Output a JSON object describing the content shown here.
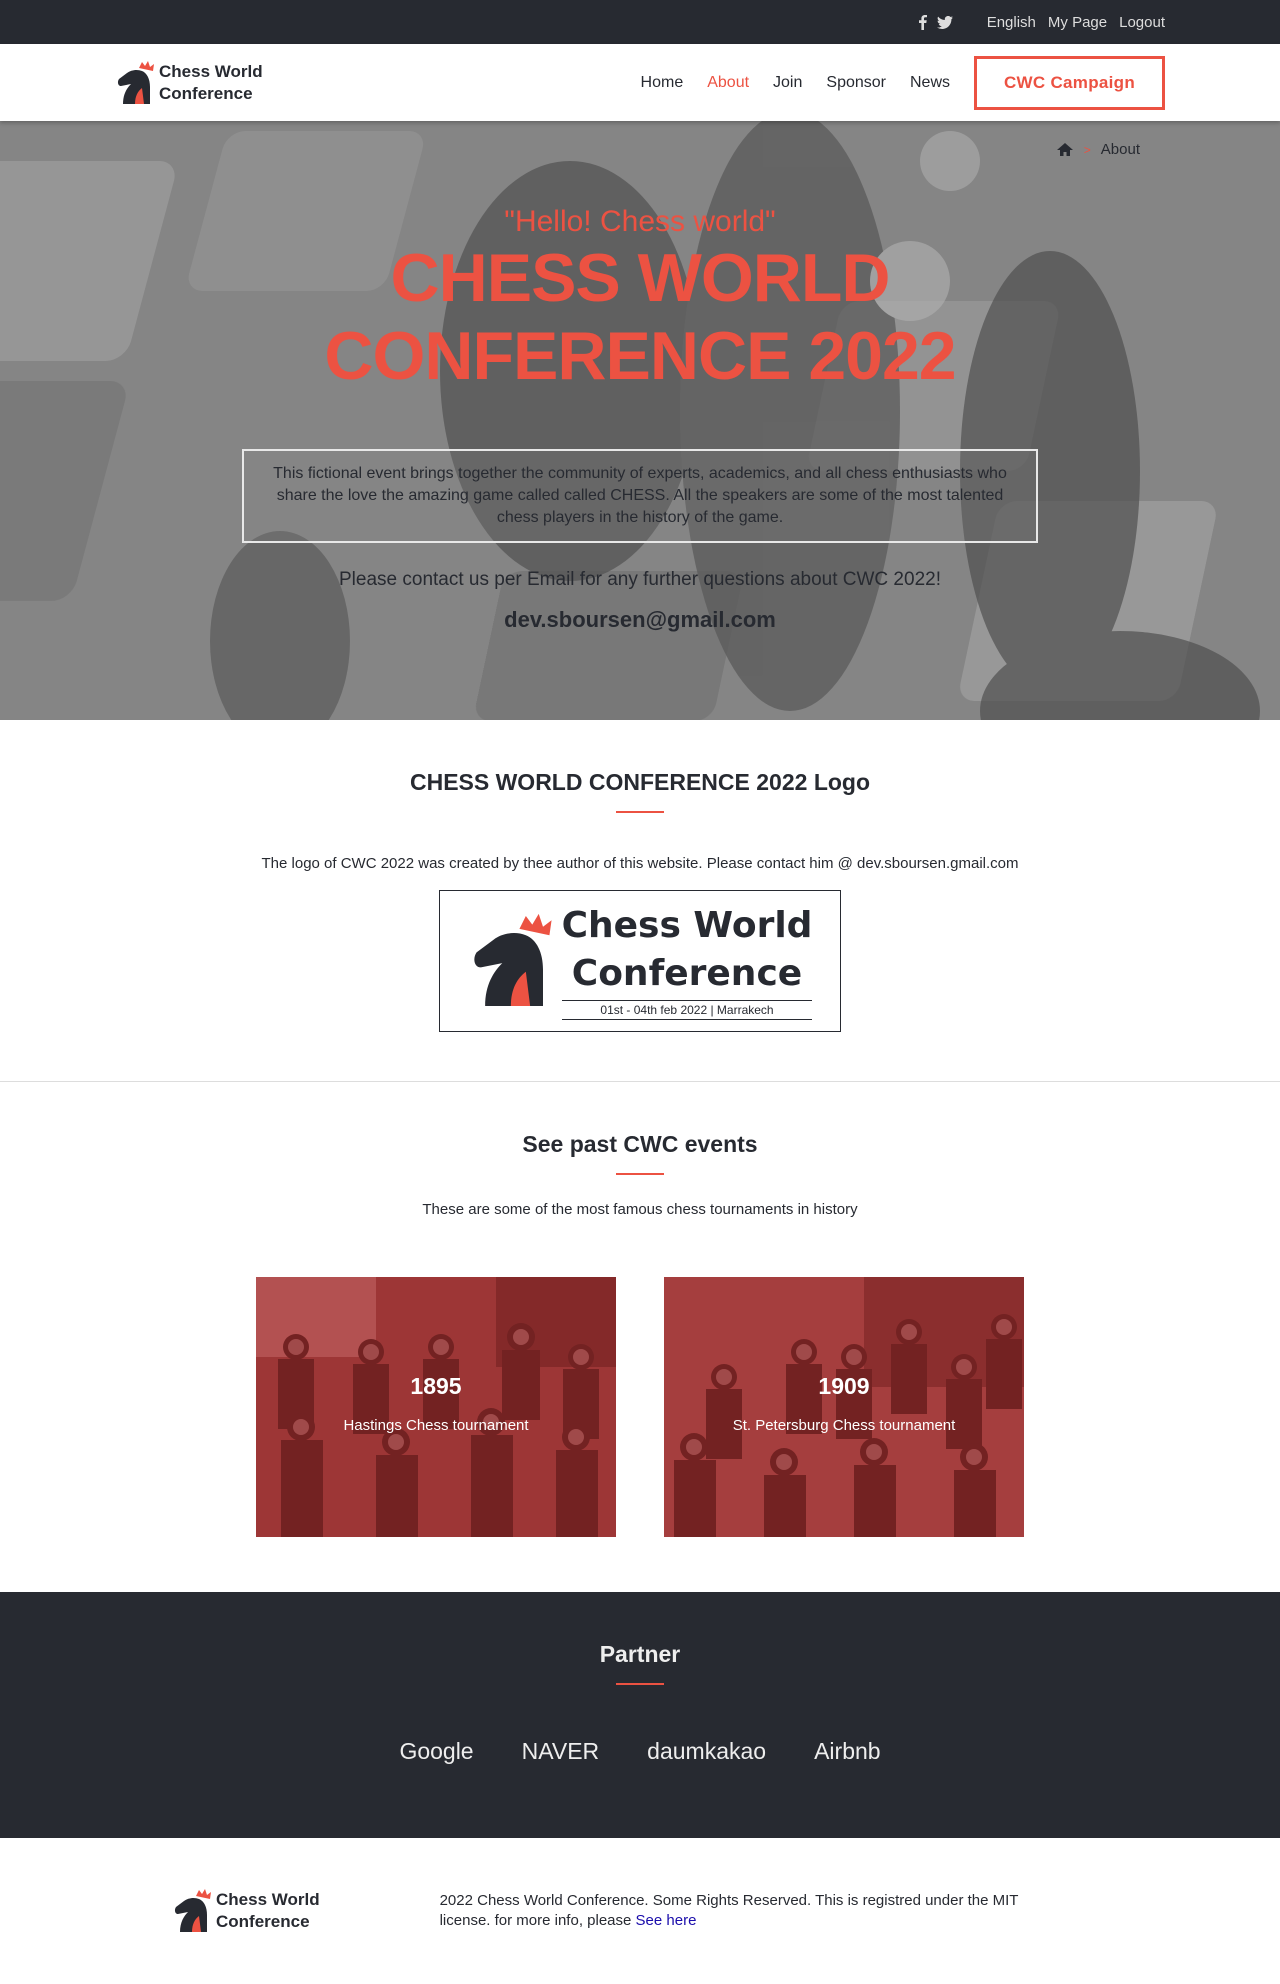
{
  "topbar": {
    "social": [
      "facebook-icon",
      "twitter-icon"
    ],
    "links": [
      "English",
      "My Page",
      "Logout"
    ]
  },
  "header": {
    "brand_line1": "Chess World",
    "brand_line2": "Conference",
    "nav": [
      "Home",
      "About",
      "Join",
      "Sponsor",
      "News"
    ],
    "active": "About",
    "cta": "CWC Campaign"
  },
  "hero": {
    "breadcrumb": "About",
    "subtitle": "\"Hello! Chess world\"",
    "title_line1": "CHESS WORLD",
    "title_line2": "CONFERENCE 2022",
    "description": "This fictional event brings together the community of experts, academics, and all chess enthusiasts who share the love the amazing game called called CHESS. All the speakers are some of the most talented chess players in the history of the game.",
    "contact": "Please contact us per Email for any further questions about CWC 2022!",
    "email": "dev.sboursen@gmail.com"
  },
  "logo_section": {
    "title": "CHESS WORLD CONFERENCE 2022 Logo",
    "text": "The logo of CWC 2022 was created by thee author of this website. Please contact him @ dev.sboursen.gmail.com",
    "logo_line1": "Chess World",
    "logo_line2": "Conference",
    "logo_dates": "01st - 04th feb 2022 | Marrakech"
  },
  "events": {
    "title": "See past CWC events",
    "subtitle": "These are some of the most famous chess tournaments in history",
    "cards": [
      {
        "year": "1895",
        "name": "Hastings Chess tournament"
      },
      {
        "year": "1909",
        "name": "St. Petersburg Chess tournament"
      }
    ]
  },
  "partner": {
    "title": "Partner",
    "names": [
      "Google",
      "NAVER",
      "daumkakao",
      "Airbnb"
    ]
  },
  "footer": {
    "brand_line1": "Chess World",
    "brand_line2": "Conference",
    "text": "2022 Chess World Conference. Some Rights Reserved. This is registred under the MIT license. for more info, please ",
    "link": "See here"
  },
  "colors": {
    "accent": "#ec5242",
    "dark": "#272a31"
  }
}
